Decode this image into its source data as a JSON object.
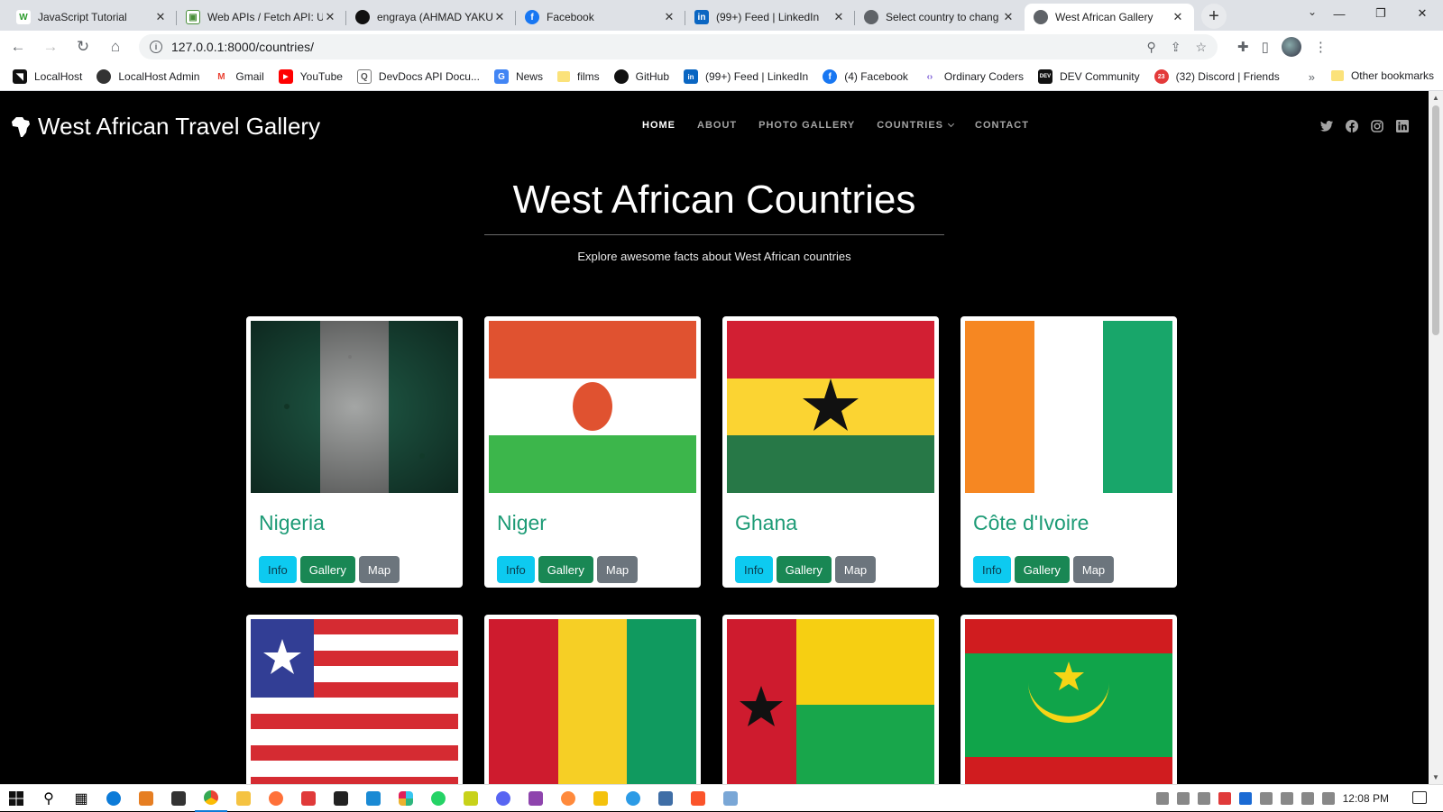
{
  "browser": {
    "tabs": [
      {
        "title": "JavaScript Tutorial",
        "fav_color": "#2d9c2d",
        "fav_text": "W"
      },
      {
        "title": "Web APIs / Fetch API: U",
        "fav_color": "#4a8f3a",
        "fav_text": "▣"
      },
      {
        "title": "engraya (AHMAD YAKU",
        "fav_color": "#111111",
        "fav_text": "●"
      },
      {
        "title": "Facebook",
        "fav_color": "#1877f2",
        "fav_text": "f"
      },
      {
        "title": "(99+) Feed | LinkedIn",
        "fav_color": "#0a66c2",
        "fav_text": "in"
      },
      {
        "title": "Select country to chang",
        "fav_color": "#5f6368",
        "fav_text": "◍"
      },
      {
        "title": "West African Gallery",
        "fav_color": "#5f6368",
        "fav_text": "◍"
      }
    ],
    "active_tab": 6,
    "url": "127.0.0.1:8000/countries/",
    "bookmarks": [
      {
        "label": "LocalHost",
        "fav_color": "#111111",
        "fav_text": "◥"
      },
      {
        "label": "LocalHost Admin",
        "fav_color": "#333333",
        "fav_text": "◍"
      },
      {
        "label": "Gmail",
        "fav_color": "#ea4335",
        "fav_text": "M"
      },
      {
        "label": "YouTube",
        "fav_color": "#ff0000",
        "fav_text": "▶"
      },
      {
        "label": "DevDocs API Docu...",
        "fav_color": "#666666",
        "fav_text": "Q"
      },
      {
        "label": "News",
        "fav_color": "#4285f4",
        "fav_text": "G"
      },
      {
        "label": "films",
        "fav_color": "#fbe27a",
        "fav_text": ""
      },
      {
        "label": "GitHub",
        "fav_color": "#111111",
        "fav_text": "●"
      },
      {
        "label": "(99+) Feed | LinkedIn",
        "fav_color": "#0a66c2",
        "fav_text": "in"
      },
      {
        "label": "(4) Facebook",
        "fav_color": "#1877f2",
        "fav_text": "f"
      },
      {
        "label": "Ordinary Coders",
        "fav_color": "#7b5cd6",
        "fav_text": "‹›"
      },
      {
        "label": "DEV Community",
        "fav_color": "#111111",
        "fav_text": "DEV"
      },
      {
        "label": "(32) Discord | Friends",
        "fav_color": "#e33a3a",
        "fav_text": "23"
      }
    ],
    "other_bookmarks": "Other bookmarks"
  },
  "site": {
    "brand": "West African Travel Gallery",
    "nav": [
      {
        "label": "HOME",
        "active": true
      },
      {
        "label": "ABOUT",
        "active": false
      },
      {
        "label": "PHOTO GALLERY",
        "active": false
      },
      {
        "label": "COUNTRIES",
        "active": false,
        "dropdown": true
      },
      {
        "label": "CONTACT",
        "active": false
      }
    ],
    "social_icons": [
      "twitter-icon",
      "facebook-icon",
      "instagram-icon",
      "linkedin-icon"
    ],
    "hero_title": "West African Countries",
    "hero_subtitle": "Explore awesome facts about West African countries",
    "buttons": {
      "info": "Info",
      "gallery": "Gallery",
      "map": "Map"
    },
    "countries": [
      {
        "name": "Nigeria",
        "flag": "nigeria"
      },
      {
        "name": "Niger",
        "flag": "niger"
      },
      {
        "name": "Ghana",
        "flag": "ghana"
      },
      {
        "name": "Côte d'Ivoire",
        "flag": "cote-divoire"
      },
      {
        "name": "",
        "flag": "liberia"
      },
      {
        "name": "",
        "flag": "guinea"
      },
      {
        "name": "",
        "flag": "guinea-bissau"
      },
      {
        "name": "",
        "flag": "mauritania"
      }
    ],
    "colors": {
      "accent_green": "#1d9b76",
      "info": "#0dcaf0",
      "success": "#198754",
      "secondary": "#6c757d"
    }
  },
  "taskbar": {
    "time": "12:08 PM"
  }
}
